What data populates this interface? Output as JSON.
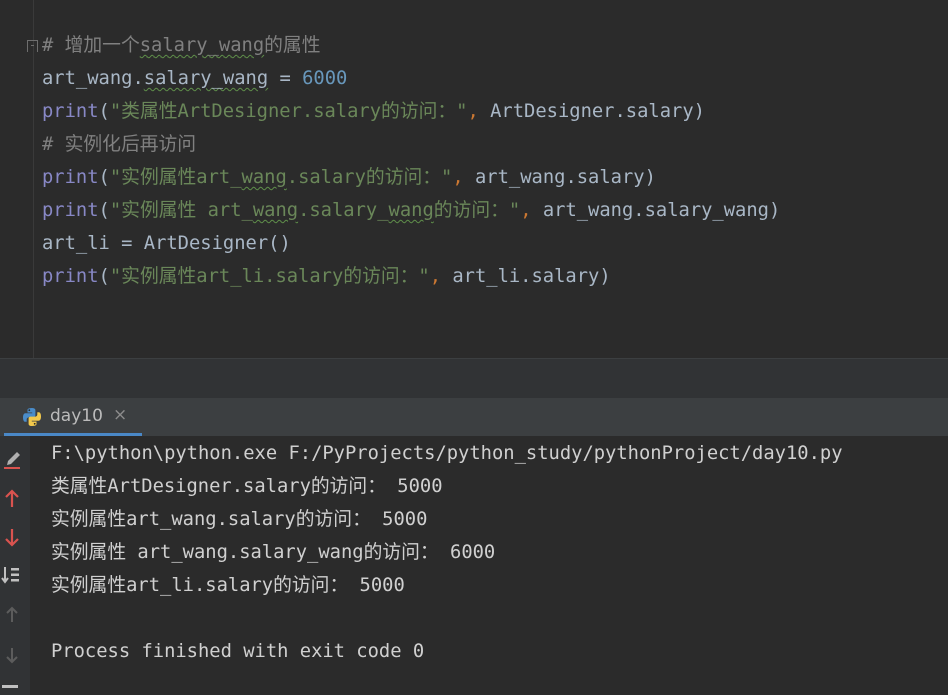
{
  "editor": {
    "lines": [
      [
        {
          "t": "# 增加一个",
          "c": "cmt"
        },
        {
          "t": "salary_wang",
          "c": "cmt wavy"
        },
        {
          "t": "的属性",
          "c": "cmt"
        }
      ],
      [
        {
          "t": "art_wang.",
          "c": ""
        },
        {
          "t": "salary_wang",
          "c": "wavy"
        },
        {
          "t": " = ",
          "c": ""
        },
        {
          "t": "6000",
          "c": "num"
        }
      ],
      [
        {
          "t": "print",
          "c": "kw"
        },
        {
          "t": "(",
          "c": ""
        },
        {
          "t": "\"类属性ArtDesigner.salary的访问：\"",
          "c": "str"
        },
        {
          "t": ", ",
          "c": "op"
        },
        {
          "t": "ArtDesigner.salary)",
          "c": ""
        }
      ],
      [
        {
          "t": "# 实例化后再访问",
          "c": "cmt"
        }
      ],
      [
        {
          "t": "print",
          "c": "kw"
        },
        {
          "t": "(",
          "c": ""
        },
        {
          "t": "\"实例属性art_",
          "c": "str"
        },
        {
          "t": "wang",
          "c": "str wavy"
        },
        {
          "t": ".salary的访问：\"",
          "c": "str"
        },
        {
          "t": ", ",
          "c": "op"
        },
        {
          "t": "art_wang.salary)",
          "c": ""
        }
      ],
      [
        {
          "t": "print",
          "c": "kw"
        },
        {
          "t": "(",
          "c": ""
        },
        {
          "t": "\"实例属性 art_",
          "c": "str"
        },
        {
          "t": "wang",
          "c": "str wavy"
        },
        {
          "t": ".salary_",
          "c": "str"
        },
        {
          "t": "wang",
          "c": "str wavy"
        },
        {
          "t": "的访问：\"",
          "c": "str"
        },
        {
          "t": ", ",
          "c": "op"
        },
        {
          "t": "art_wang.salary_wang)",
          "c": ""
        }
      ],
      [
        {
          "t": "art_li = ArtDesigner()",
          "c": ""
        }
      ],
      [
        {
          "t": "print",
          "c": "kw"
        },
        {
          "t": "(",
          "c": ""
        },
        {
          "t": "\"实例属性art_li.salary的访问：\"",
          "c": "str"
        },
        {
          "t": ", ",
          "c": "op"
        },
        {
          "t": "art_li.salary)",
          "c": ""
        }
      ]
    ]
  },
  "run_tab": {
    "label": "day10",
    "close": "×"
  },
  "toolbar": {
    "icons": [
      "pencil-icon",
      "arrow-up-icon",
      "arrow-down-icon",
      "sort-down-icon",
      "scroll-up-icon",
      "scroll-down-icon"
    ]
  },
  "console": {
    "lines": [
      "F:\\python\\python.exe F:/PyProjects/python_study/pythonProject/day10.py",
      "类属性ArtDesigner.salary的访问： 5000",
      "实例属性art_wang.salary的访问： 5000",
      "实例属性 art_wang.salary_wang的访问： 6000",
      "实例属性art_li.salary的访问： 5000",
      "",
      "Process finished with exit code 0"
    ]
  }
}
